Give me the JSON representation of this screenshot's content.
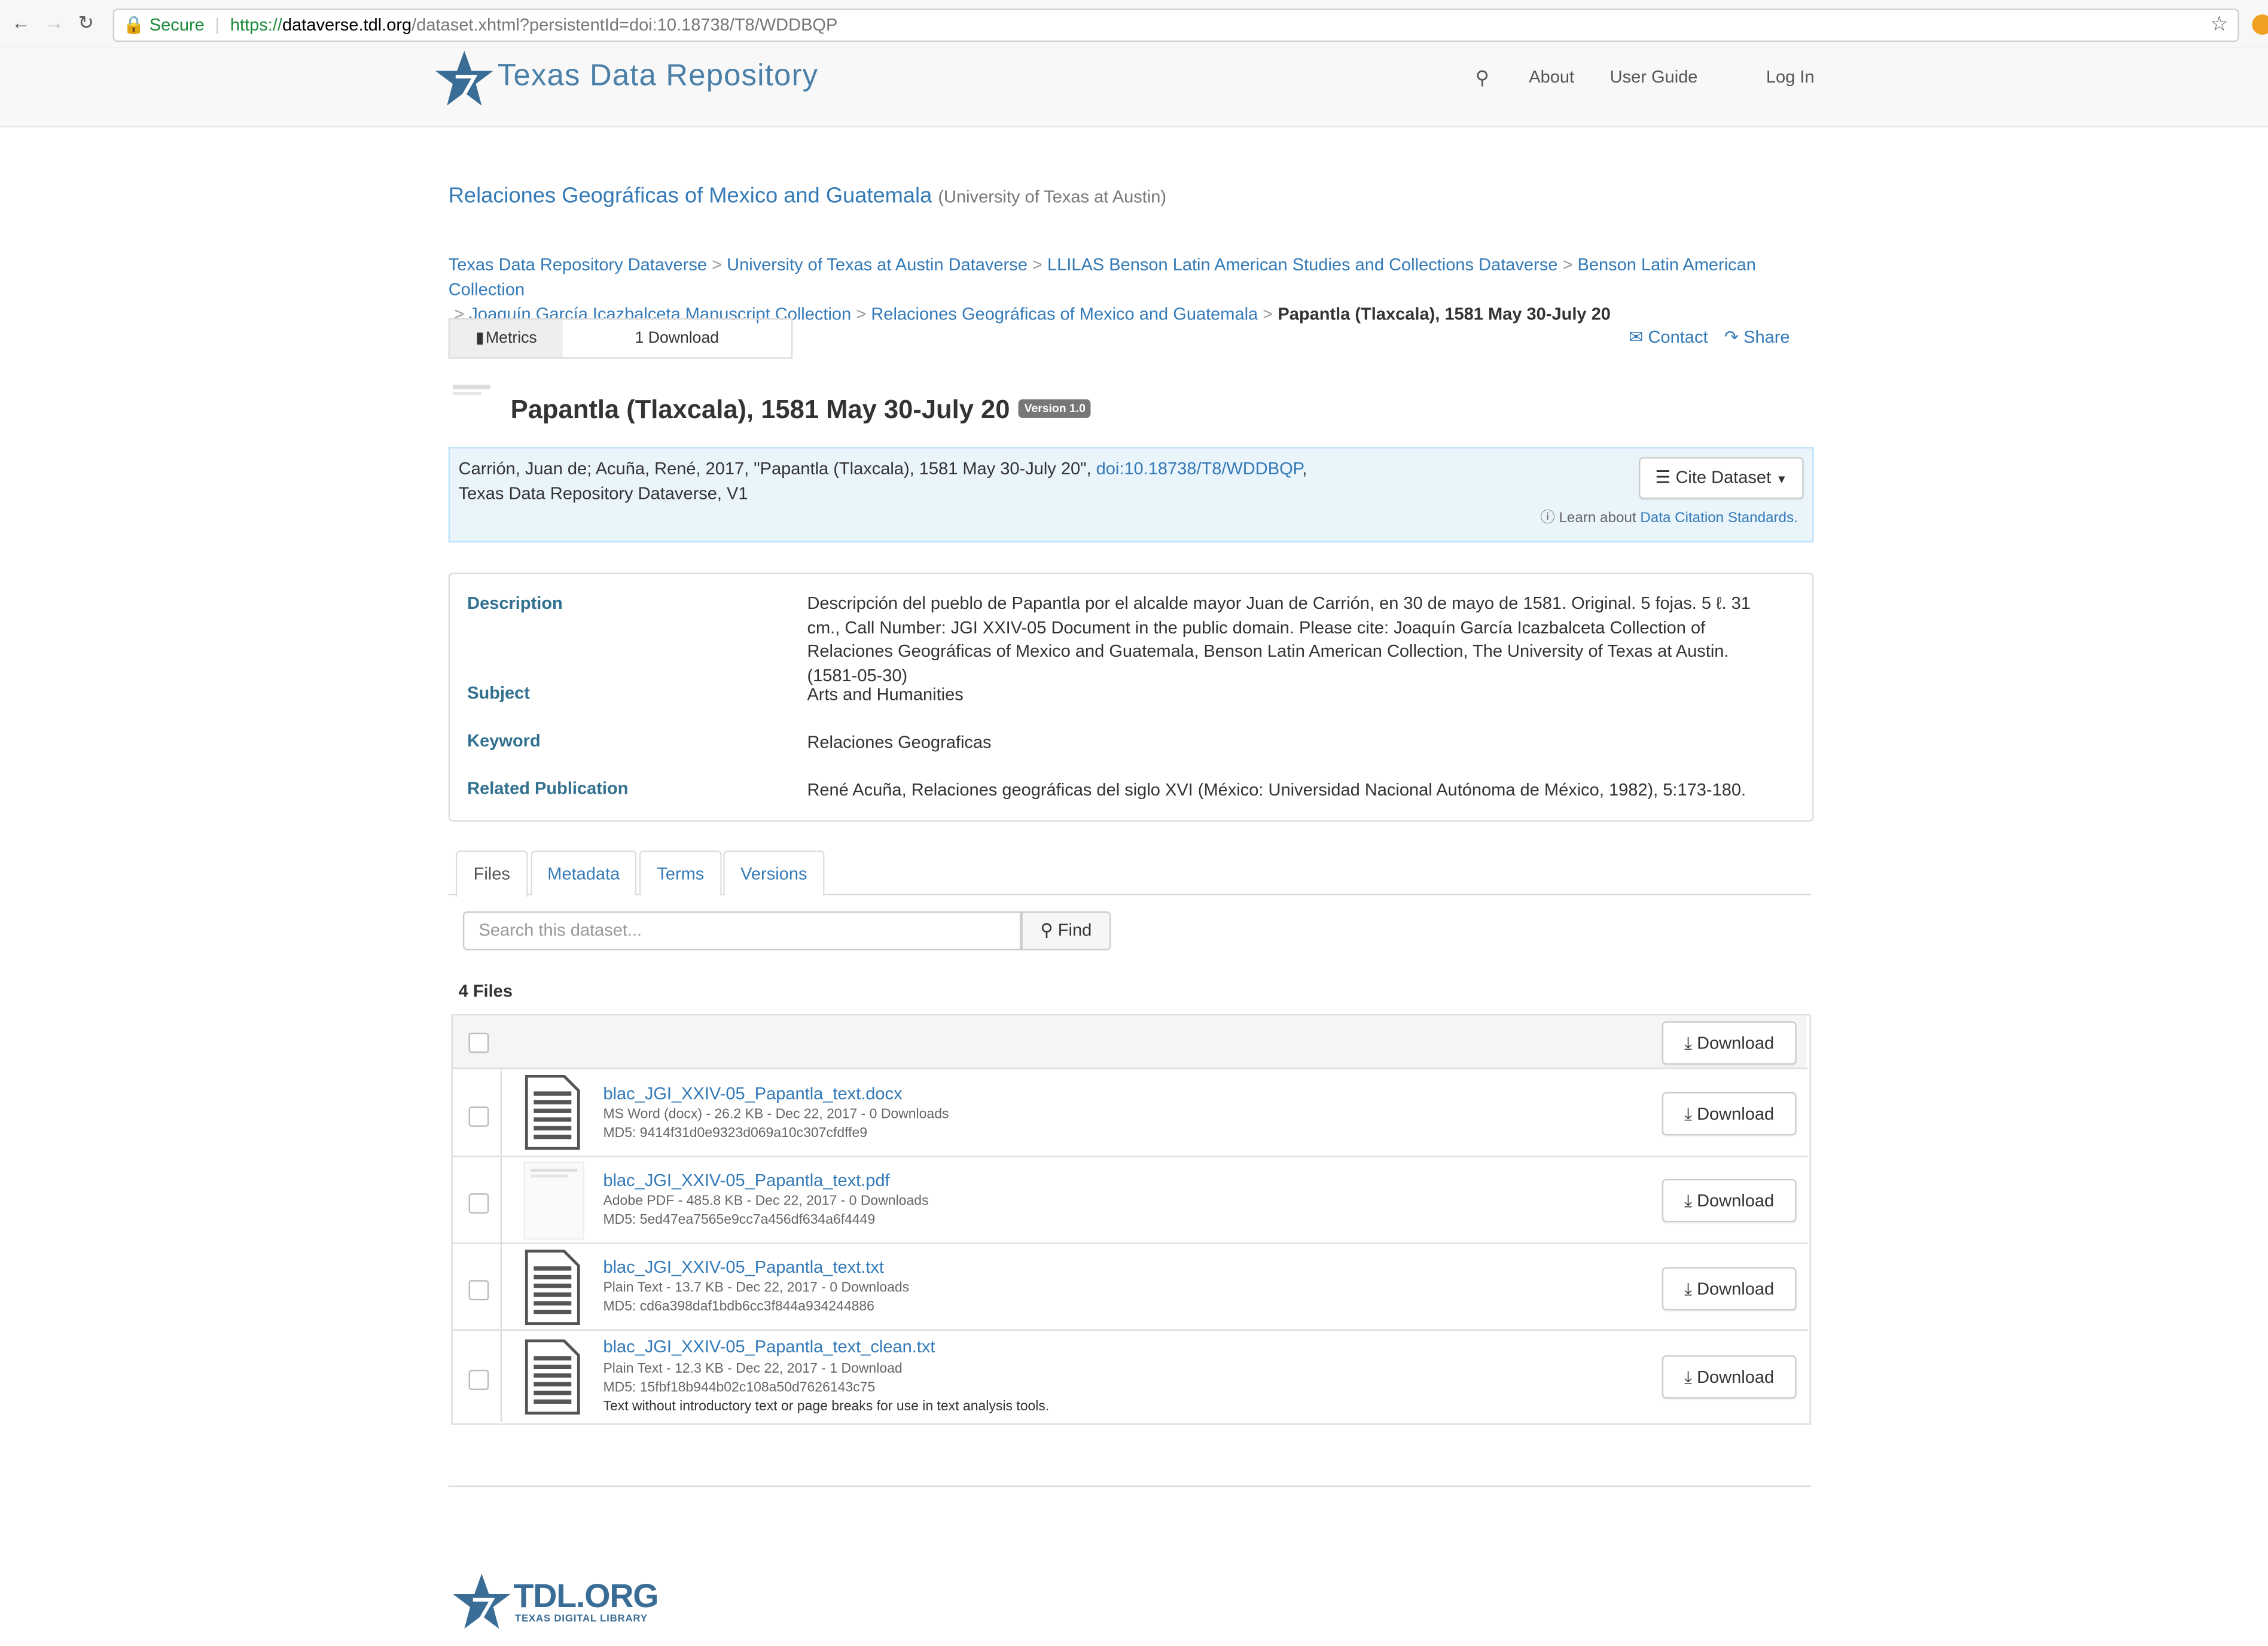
{
  "browser": {
    "secure_label": "Secure",
    "url_scheme": "https://",
    "url_host": "dataverse.tdl.org",
    "url_path": "/dataset.xhtml?persistentId=doi:10.18738/T8/WDDBQP"
  },
  "header": {
    "brand": "Texas Data Repository",
    "nav": {
      "about": "About",
      "user_guide": "User Guide",
      "login": "Log In"
    }
  },
  "dataverse": {
    "name": "Relaciones Geográficas of Mexico and Guatemala",
    "affiliation": "(University of Texas at Austin)"
  },
  "breadcrumbs": {
    "items": [
      "Texas Data Repository Dataverse",
      "University of Texas at Austin Dataverse",
      "LLILAS Benson Latin American Studies and Collections Dataverse",
      "Benson Latin American Collection",
      "Joaquín García Icazbalceta Manuscript Collection",
      "Relaciones Geográficas of Mexico and Guatemala"
    ],
    "current": "Papantla (Tlaxcala), 1581 May 30-July 20",
    "separator": ">"
  },
  "metrics": {
    "label": "Metrics",
    "value": "1 Download"
  },
  "actions": {
    "contact": "Contact",
    "share": "Share"
  },
  "dataset": {
    "title": "Papantla (Tlaxcala), 1581 May 30-July 20",
    "version": "Version 1.0"
  },
  "citation": {
    "text_before": "Carrión, Juan de; Acuña, René, 2017, \"Papantla (Tlaxcala), 1581 May 30-July 20\", ",
    "doi": "doi:10.18738/T8/WDDBQP",
    "text_after": ", Texas Data Repository Dataverse, V1",
    "cite_button": "Cite Dataset",
    "learn_prefix": "Learn about ",
    "learn_link": "Data Citation Standards."
  },
  "metadata": {
    "description_label": "Description",
    "description": "Descripción del pueblo de Papantla por el alcalde mayor Juan de Carrión, en 30 de mayo de 1581. Original. 5 fojas. 5 ℓ. 31 cm., Call Number: JGI XXIV-05 Document in the public domain. Please cite: Joaquín García Icazbalceta Collection of Relaciones Geográficas of Mexico and Guatemala, Benson Latin American Collection, The University of Texas at Austin. (1581-05-30)",
    "subject_label": "Subject",
    "subject": "Arts and Humanities",
    "keyword_label": "Keyword",
    "keyword": "Relaciones Geograficas",
    "related_label": "Related Publication",
    "related": "René Acuña, Relaciones geográficas del siglo XVI (México: Universidad Nacional Autónoma de México, 1982), 5:173-180."
  },
  "tabs": [
    "Files",
    "Metadata",
    "Terms",
    "Versions"
  ],
  "files": {
    "search_placeholder": "Search this dataset...",
    "find_label": "Find",
    "count_label": "4 Files",
    "download_label": "Download",
    "items": [
      {
        "name": "blac_JGI_XXIV-05_Papantla_text.docx",
        "meta": "MS Word (docx) - 26.2 KB - Dec 22, 2017 - 0 Downloads",
        "md5": "MD5: 9414f31d0e9323d069a10c307cfdffe9",
        "desc": "",
        "icon": "document-icon"
      },
      {
        "name": "blac_JGI_XXIV-05_Papantla_text.pdf",
        "meta": "Adobe PDF - 485.8 KB - Dec 22, 2017 - 0 Downloads",
        "md5": "MD5: 5ed47ea7565e9cc7a456df634a6f4449",
        "desc": "",
        "icon": "pdf-thumbnail"
      },
      {
        "name": "blac_JGI_XXIV-05_Papantla_text.txt",
        "meta": "Plain Text - 13.7 KB - Dec 22, 2017 - 0 Downloads",
        "md5": "MD5: cd6a398daf1bdb6cc3f844a934244886",
        "desc": "",
        "icon": "document-icon"
      },
      {
        "name": "blac_JGI_XXIV-05_Papantla_text_clean.txt",
        "meta": "Plain Text - 12.3 KB - Dec 22, 2017 - 1 Download",
        "md5": "MD5: 15fbf18b944b02c108a50d7626143c75",
        "desc": "Text without introductory text or page breaks for use in text analysis tools.",
        "icon": "document-icon"
      }
    ]
  },
  "footer": {
    "logo_text": "TDL.ORG",
    "logo_sub": "TEXAS DIGITAL LIBRARY"
  }
}
